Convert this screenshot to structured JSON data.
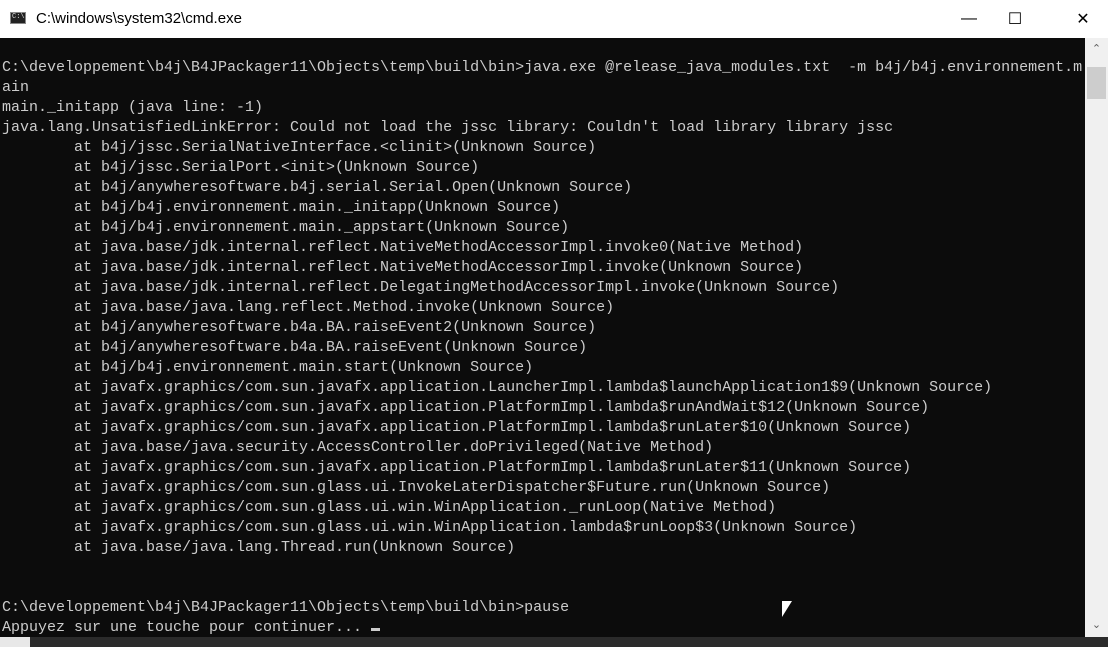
{
  "window": {
    "title": "C:\\windows\\system32\\cmd.exe",
    "minimize": "—",
    "maximize": "☐",
    "close": "✕"
  },
  "console": {
    "lines": [
      "C:\\developpement\\b4j\\B4JPackager11\\Objects\\temp\\build\\bin>java.exe @release_java_modules.txt  -m b4j/b4j.environnement.m",
      "ain",
      "main._initapp (java line: -1)",
      "java.lang.UnsatisfiedLinkError: Could not load the jssc library: Couldn't load library library jssc",
      "        at b4j/jssc.SerialNativeInterface.<clinit>(Unknown Source)",
      "        at b4j/jssc.SerialPort.<init>(Unknown Source)",
      "        at b4j/anywheresoftware.b4j.serial.Serial.Open(Unknown Source)",
      "        at b4j/b4j.environnement.main._initapp(Unknown Source)",
      "        at b4j/b4j.environnement.main._appstart(Unknown Source)",
      "        at java.base/jdk.internal.reflect.NativeMethodAccessorImpl.invoke0(Native Method)",
      "        at java.base/jdk.internal.reflect.NativeMethodAccessorImpl.invoke(Unknown Source)",
      "        at java.base/jdk.internal.reflect.DelegatingMethodAccessorImpl.invoke(Unknown Source)",
      "        at java.base/java.lang.reflect.Method.invoke(Unknown Source)",
      "        at b4j/anywheresoftware.b4a.BA.raiseEvent2(Unknown Source)",
      "        at b4j/anywheresoftware.b4a.BA.raiseEvent(Unknown Source)",
      "        at b4j/b4j.environnement.main.start(Unknown Source)",
      "        at javafx.graphics/com.sun.javafx.application.LauncherImpl.lambda$launchApplication1$9(Unknown Source)",
      "        at javafx.graphics/com.sun.javafx.application.PlatformImpl.lambda$runAndWait$12(Unknown Source)",
      "        at javafx.graphics/com.sun.javafx.application.PlatformImpl.lambda$runLater$10(Unknown Source)",
      "        at java.base/java.security.AccessController.doPrivileged(Native Method)",
      "        at javafx.graphics/com.sun.javafx.application.PlatformImpl.lambda$runLater$11(Unknown Source)",
      "        at javafx.graphics/com.sun.glass.ui.InvokeLaterDispatcher$Future.run(Unknown Source)",
      "        at javafx.graphics/com.sun.glass.ui.win.WinApplication._runLoop(Native Method)",
      "        at javafx.graphics/com.sun.glass.ui.win.WinApplication.lambda$runLoop$3(Unknown Source)",
      "        at java.base/java.lang.Thread.run(Unknown Source)",
      "",
      "",
      "C:\\developpement\\b4j\\B4JPackager11\\Objects\\temp\\build\\bin>pause",
      "Appuyez sur une touche pour continuer... "
    ]
  }
}
